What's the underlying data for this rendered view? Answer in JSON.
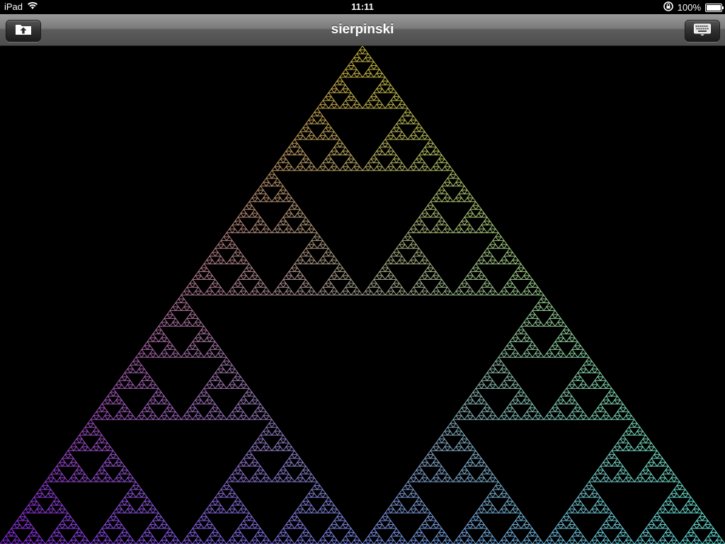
{
  "status_bar": {
    "device": "iPad",
    "time": "11:11",
    "battery_text": "100%",
    "battery_level": 1.0
  },
  "nav_bar": {
    "title": "sierpinski",
    "left_button_icon": "upload-folder-icon",
    "right_button_icon": "keyboard-icon"
  },
  "fractal": {
    "type": "sierpinski-triangle",
    "depth": 7,
    "colors": {
      "top": "#c8b43c",
      "bottom_left": "#8a2be2",
      "bottom_right": "#5fe0d8"
    }
  }
}
